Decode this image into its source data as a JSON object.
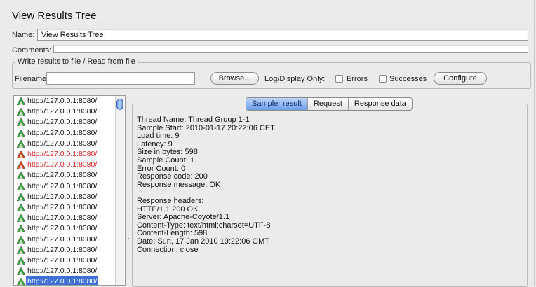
{
  "title": "View Results Tree",
  "name_label": "Name:",
  "name_value": "View Results Tree",
  "comments_label": "Comments:",
  "comments_value": "",
  "file_group": {
    "legend": "Write results to file / Read from file",
    "filename_label": "Filename",
    "filename_value": "",
    "browse_label": "Browse...",
    "log_display_label": "Log/Display Only:",
    "errors_label": "Errors",
    "successes_label": "Successes",
    "configure_label": "Configure"
  },
  "tree": {
    "items": [
      {
        "text": "http://127.0.0.1:8080/",
        "status": "ok"
      },
      {
        "text": "http://127.0.0.1:8080/",
        "status": "ok"
      },
      {
        "text": "http://127.0.0.1:8080/",
        "status": "ok"
      },
      {
        "text": "http://127.0.0.1:8080/",
        "status": "ok"
      },
      {
        "text": "http://127.0.0.1:8080/",
        "status": "ok"
      },
      {
        "text": "http://127.0.0.1:8080/",
        "status": "error"
      },
      {
        "text": "http://127.0.0.1:8080/",
        "status": "error"
      },
      {
        "text": "http://127.0.0.1:8080/",
        "status": "ok"
      },
      {
        "text": "http://127.0.0.1:8080/",
        "status": "ok"
      },
      {
        "text": "http://127.0.0.1:8080/",
        "status": "ok"
      },
      {
        "text": "http://127.0.0.1:8080/",
        "status": "ok"
      },
      {
        "text": "http://127.0.0.1:8080/",
        "status": "ok"
      },
      {
        "text": "http://127.0.0.1:8080/",
        "status": "ok"
      },
      {
        "text": "http://127.0.0.1:8080/",
        "status": "ok"
      },
      {
        "text": "http://127.0.0.1:8080/",
        "status": "ok"
      },
      {
        "text": "http://127.0.0.1:8080/",
        "status": "ok"
      },
      {
        "text": "http://127.0.0.1:8080/",
        "status": "ok"
      },
      {
        "text": "http://127.0.0.1:8080/",
        "status": "selected"
      }
    ]
  },
  "tabs": [
    {
      "label": "Sampler result",
      "active": true
    },
    {
      "label": "Request",
      "active": false
    },
    {
      "label": "Response data",
      "active": false
    }
  ],
  "sampler_result": {
    "lines": [
      "Thread Name: Thread Group 1-1",
      "Sample Start: 2010-01-17 20:22:06 CET",
      "Load time: 9",
      "Latency: 9",
      "Size in bytes: 598",
      "Sample Count: 1",
      "Error Count: 0",
      "Response code: 200",
      "Response message: OK",
      "",
      "Response headers:",
      "HTTP/1.1 200 OK",
      "Server: Apache-Coyote/1.1",
      "Content-Type: text/html;charset=UTF-8",
      "Content-Length: 598",
      "Date: Sun, 17 Jan 2010 19:22:06 GMT",
      "Connection: close"
    ]
  },
  "colors": {
    "ok_icon": "#3aa23a",
    "error_icon": "#d0421b",
    "selection": "#3d6fd6",
    "active_tab": "#6f9fe8"
  }
}
